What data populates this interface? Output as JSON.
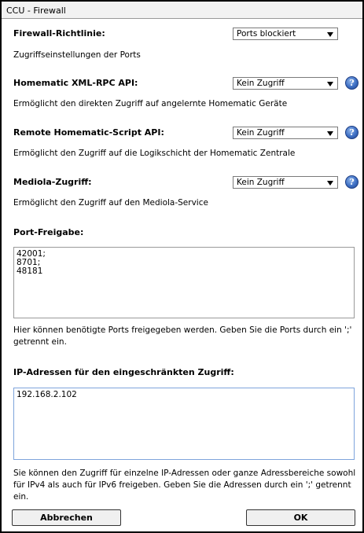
{
  "window": {
    "title": "CCU - Firewall"
  },
  "firewall": {
    "label": "Firewall-Richtlinie:",
    "value": "Ports blockiert",
    "desc": "Zugriffseinstellungen der Ports"
  },
  "xmlrpc": {
    "label": "Homematic XML-RPC API:",
    "value": "Kein Zugriff",
    "desc": "Ermöglicht den direkten Zugriff auf angelernte Homematic Geräte"
  },
  "script": {
    "label": "Remote Homematic-Script API:",
    "value": "Kein Zugriff",
    "desc": "Ermöglicht den Zugriff auf die Logikschicht der Homematic Zentrale"
  },
  "mediola": {
    "label": "Mediola-Zugriff:",
    "value": "Kein Zugriff",
    "desc": "Ermöglicht den Zugriff auf den Mediola-Service"
  },
  "help_glyph": "?",
  "ports": {
    "label": "Port-Freigabe:",
    "value": "42001;\n8701;\n48181",
    "desc": "Hier können benötigte Ports freigegeben werden. Geben Sie die Ports durch ein ';' getrennt ein."
  },
  "ip": {
    "label": "IP-Adressen für den eingeschränkten Zugriff:",
    "value": "192.168.2.102",
    "desc": "Sie können den Zugriff für einzelne IP-Adressen oder ganze Adressbereiche sowohl für IPv4 als auch für IPv6 freigeben. Geben Sie die Adressen durch ein ';' getrennt ein."
  },
  "buttons": {
    "cancel": "Abbrechen",
    "ok": "OK"
  }
}
